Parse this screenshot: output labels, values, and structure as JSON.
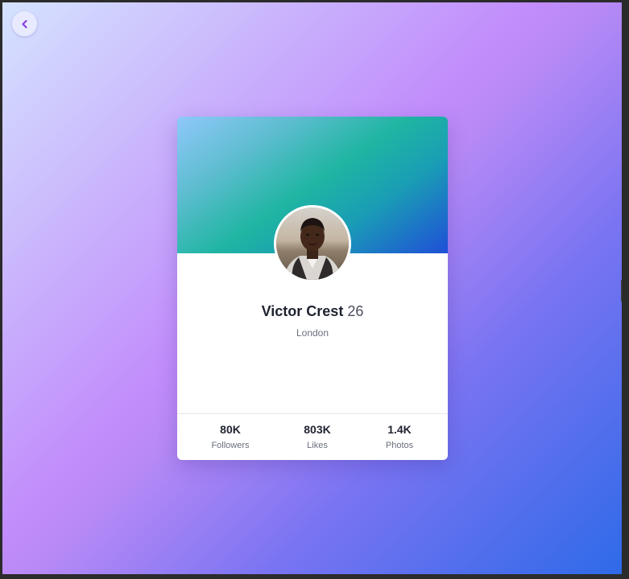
{
  "navigation": {
    "back_icon": "chevron-left-icon"
  },
  "profile": {
    "name": "Victor Crest",
    "age": "26",
    "location": "London",
    "avatar_icon": "profile-photo"
  },
  "stats": [
    {
      "value": "80K",
      "label": "Followers"
    },
    {
      "value": "803K",
      "label": "Likes"
    },
    {
      "value": "1.4K",
      "label": "Photos"
    }
  ],
  "colors": {
    "background_start": "#d4e3fe",
    "background_mid": "#c18cfb",
    "background_end": "#2e6ae8",
    "banner_start": "#8fc8fa",
    "banner_mid": "#1fb5a2",
    "banner_end": "#1f4fd7",
    "back_arrow": "#8b3fe3",
    "text_dark": "#1f2330",
    "text_muted": "#6a6f7c"
  }
}
